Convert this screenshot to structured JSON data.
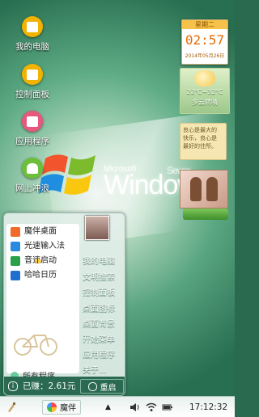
{
  "desktop": {
    "icons": [
      {
        "label": "我的电脑",
        "icon": "computer-icon",
        "color": "#f2b300"
      },
      {
        "label": "控制面板",
        "icon": "control-panel-icon",
        "color": "#f2b300"
      },
      {
        "label": "应用程序",
        "icon": "apps-icon",
        "color": "#e8577e"
      },
      {
        "label": "网上冲浪",
        "icon": "android-icon",
        "color": "#6bbf39"
      }
    ],
    "wallpaper": {
      "brand_small": "Microsoft",
      "brand_big": "Windows",
      "edition": "Seven"
    }
  },
  "widgets": {
    "clock": {
      "weekday": "星期二",
      "time": "02:57",
      "date": "2014年05月26日"
    },
    "weather": {
      "temp": "22℃~32℃",
      "cond": "多云转晴"
    },
    "note": {
      "text": "良心是最大的 快乐，良心是 最好的住所。"
    }
  },
  "start_menu": {
    "left_items": [
      {
        "label": "魔伴桌面",
        "icon": "moban-icon",
        "color": "#f06a2a"
      },
      {
        "label": "光速输入法",
        "icon": "input-method-icon",
        "color": "#2a8ae0"
      },
      {
        "label": "音速启动",
        "icon": "launcher-icon",
        "color": "#2aa04a"
      },
      {
        "label": "哈哈日历",
        "icon": "calendar-icon",
        "color": "#1e6fd0"
      }
    ],
    "all_programs": "所有程序",
    "right_links": [
      "我的电脑",
      "文明搜索",
      "控制面板",
      "桌面图标",
      "桌面背景",
      "开始菜单",
      "应用程序",
      "关于..."
    ],
    "earned": "已赚：2.61元",
    "restart": "重启"
  },
  "taskbar": {
    "app": "魔伴",
    "time": "17:12:32"
  }
}
